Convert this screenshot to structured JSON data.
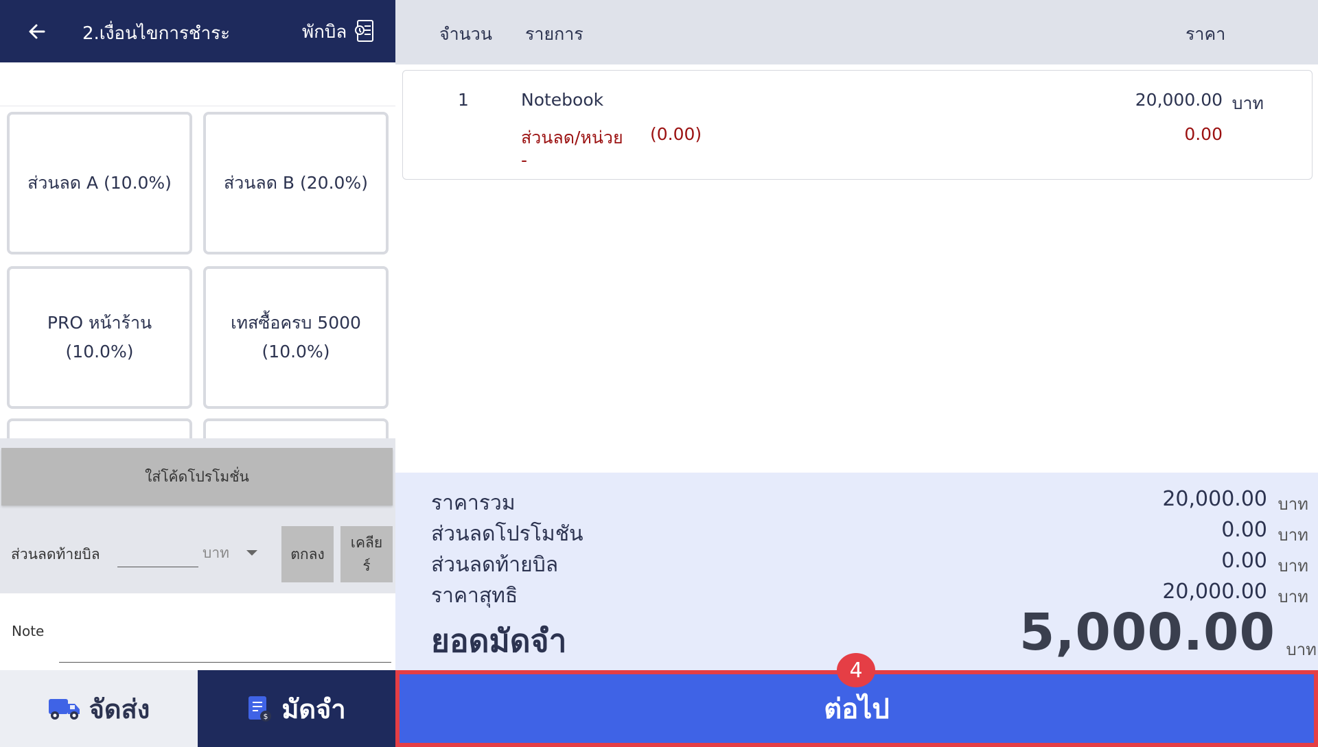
{
  "header": {
    "title": "2.เงื่อนไขการชำระ",
    "hold_bill_label": "พักบิล"
  },
  "promotions": [
    {
      "label": "ส่วนลด A (10.0%)"
    },
    {
      "label": "ส่วนลด B (20.0%)"
    },
    {
      "label": "PRO หน้าร้าน (10.0%)"
    },
    {
      "label": "เทสซื้อครบ 5000 (10.0%)"
    }
  ],
  "promo_code": {
    "button_label": "ใส่โค้ดโปรโมชั่น"
  },
  "bill_discount": {
    "label": "ส่วนลดท้ายบิล",
    "value": "",
    "unit": "บาท",
    "ok_label": "ตกลง",
    "clear_label": "เคลียร์"
  },
  "note": {
    "label": "Note",
    "value": ""
  },
  "tabs": {
    "delivery_label": "จัดส่ง",
    "deposit_label": "มัดจำ"
  },
  "cart": {
    "columns": {
      "qty": "จำนวน",
      "item": "รายการ",
      "price": "ราคา"
    },
    "items": [
      {
        "qty": "1",
        "name": "Notebook",
        "price": "20,000.00",
        "unit": "บาท",
        "discount_label": "ส่วนลด/หน่วย",
        "discount_value": "(0.00)",
        "discount_amount": "0.00",
        "note": "-"
      }
    ]
  },
  "summary": {
    "total_label": "ราคารวม",
    "total_value": "20,000.00",
    "promo_label": "ส่วนลดโปรโมชัน",
    "promo_value": "0.00",
    "bill_disc_label": "ส่วนลดท้ายบิล",
    "bill_disc_value": "0.00",
    "net_label": "ราคาสุทธิ",
    "net_value": "20,000.00",
    "deposit_label": "ยอดมัดจำ",
    "deposit_value": "5,000.00",
    "unit": "บาท"
  },
  "footer": {
    "next_label": "ต่อไป",
    "step_badge": "4"
  },
  "colors": {
    "navy": "#1e2a5c",
    "primary_blue": "#3f63e6",
    "highlight_red": "#e53e45",
    "discount_red": "#9b1111"
  }
}
